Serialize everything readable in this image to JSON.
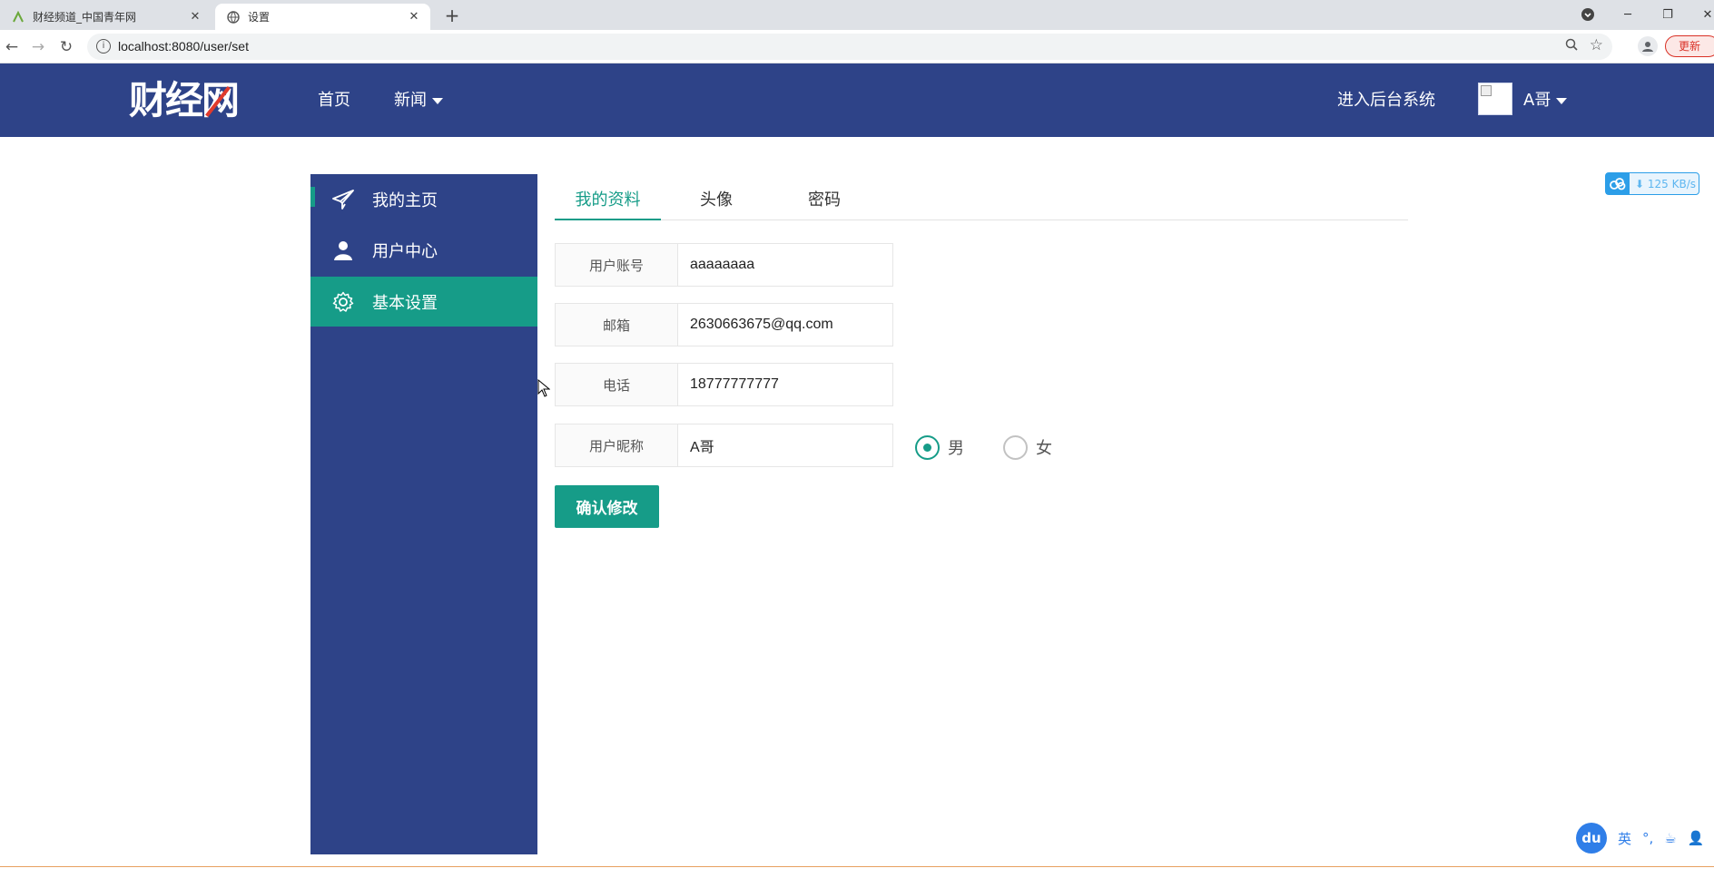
{
  "browser": {
    "tabs": [
      {
        "title": "财经频道_中国青年网",
        "active": false
      },
      {
        "title": "设置",
        "active": true
      }
    ],
    "url": "localhost:8080/user/set",
    "update_label": "更新"
  },
  "header": {
    "logo_text": "财经网",
    "nav": {
      "home": "首页",
      "news": "新闻"
    },
    "admin_link": "进入后台系统",
    "username": "A哥"
  },
  "sidebar": {
    "items": [
      {
        "label": "我的主页",
        "icon": "paper-plane-icon",
        "active": false
      },
      {
        "label": "用户中心",
        "icon": "user-icon",
        "active": false
      },
      {
        "label": "基本设置",
        "icon": "gear-icon",
        "active": true
      }
    ]
  },
  "main": {
    "tabs": [
      {
        "label": "我的资料",
        "active": true
      },
      {
        "label": "头像",
        "active": false
      },
      {
        "label": "密码",
        "active": false
      }
    ],
    "form": {
      "account": {
        "label": "用户账号",
        "value": "aaaaaaaa"
      },
      "email": {
        "label": "邮箱",
        "value": "2630663675@qq.com"
      },
      "phone": {
        "label": "电话",
        "value": "18777777777"
      },
      "nickname": {
        "label": "用户昵称",
        "value": "A哥"
      },
      "gender": {
        "male": "男",
        "female": "女",
        "selected": "男"
      }
    },
    "submit_label": "确认修改"
  },
  "overlays": {
    "download_speed": "125 KB/s",
    "ime": {
      "logo": "du",
      "mode": "英",
      "punct": "°,"
    }
  },
  "colors": {
    "header_bg": "#2e4388",
    "accent": "#169c88"
  }
}
